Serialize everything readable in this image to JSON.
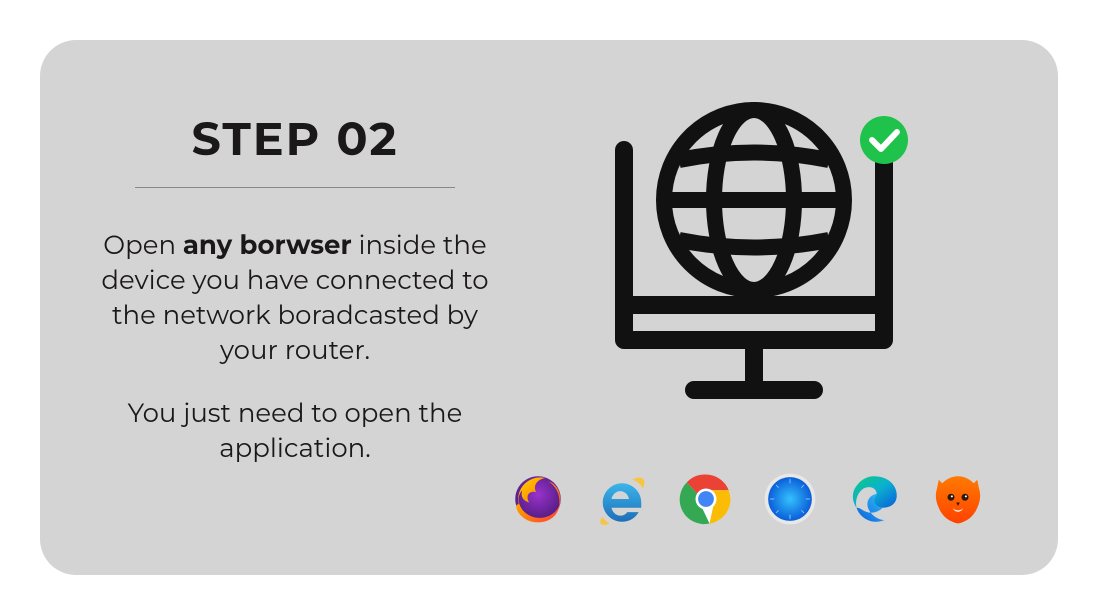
{
  "step": {
    "title": "STEP 02",
    "para1_prefix": "Open ",
    "para1_bold": "any borwser",
    "para1_suffix": " inside the device you have connected to the network boradcasted by your router.",
    "para2": "You just need to open the application."
  },
  "browsers": [
    "firefox",
    "ie",
    "chrome",
    "safari",
    "edge",
    "brave"
  ],
  "colors": {
    "check_badge": "#1fc24a"
  }
}
